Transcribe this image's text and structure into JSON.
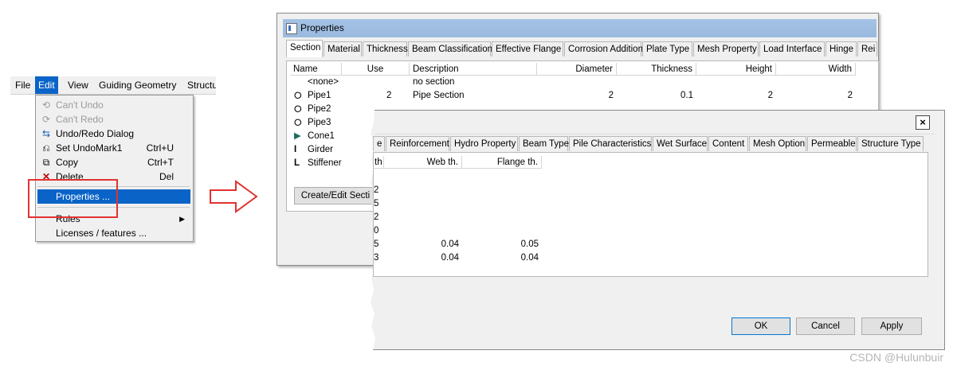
{
  "menubar": {
    "items": [
      "File",
      "Edit",
      "View",
      "Guiding Geometry",
      "Structu"
    ]
  },
  "edit_menu": {
    "items": [
      {
        "label": "Can't Undo",
        "shortcut": "",
        "icon": "undo-icon",
        "disabled": true
      },
      {
        "label": "Can't Redo",
        "shortcut": "",
        "icon": "redo-icon",
        "disabled": true
      },
      {
        "label": "Undo/Redo Dialog",
        "shortcut": "",
        "icon": "undo-redo-dialog-icon",
        "disabled": false
      },
      {
        "label": "Set UndoMark1",
        "shortcut": "Ctrl+U",
        "icon": "undo-mark-icon",
        "disabled": false
      },
      {
        "label": "Copy",
        "shortcut": "Ctrl+T",
        "icon": "copy-icon",
        "disabled": false
      },
      {
        "label": "Delete",
        "shortcut": "Del",
        "icon": "delete-icon",
        "disabled": false
      },
      {
        "label": "Properties ...",
        "shortcut": "",
        "icon": "",
        "selected": true
      },
      {
        "label": "Rules",
        "shortcut": "",
        "icon": "",
        "submenu": true
      },
      {
        "label": "Licenses / features ...",
        "shortcut": "",
        "icon": ""
      }
    ]
  },
  "properties_window": {
    "title": "Properties",
    "tabs": [
      "Section",
      "Material",
      "Thickness",
      "Beam Classification",
      "Effective Flange",
      "Corrosion Addition",
      "Plate Type",
      "Mesh Property",
      "Load Interface",
      "Hinge",
      "Rei"
    ],
    "columns": [
      "Name",
      "Use",
      "Description",
      "Diameter",
      "Thickness",
      "Height",
      "Width"
    ],
    "rows": [
      {
        "icon": "",
        "name": "<none>",
        "use": "",
        "description": "no section",
        "diameter": "",
        "thickness": "",
        "height": "",
        "width": ""
      },
      {
        "icon": "pipe-icon",
        "name": "Pipe1",
        "use": "2",
        "description": "Pipe Section",
        "diameter": "2",
        "thickness": "0.1",
        "height": "2",
        "width": "2"
      },
      {
        "icon": "pipe-icon",
        "name": "Pipe2",
        "use": "",
        "description": "",
        "diameter": "",
        "thickness": "",
        "height": "",
        "width": ""
      },
      {
        "icon": "pipe-icon",
        "name": "Pipe3",
        "use": "",
        "description": "",
        "diameter": "",
        "thickness": "",
        "height": "",
        "width": ""
      },
      {
        "icon": "cone-icon",
        "name": "Cone1",
        "use": "",
        "description": "",
        "diameter": "",
        "thickness": "",
        "height": "",
        "width": ""
      },
      {
        "icon": "i-beam-icon",
        "name": "Girder",
        "use": "",
        "description": "",
        "diameter": "",
        "thickness": "",
        "height": "",
        "width": ""
      },
      {
        "icon": "l-profile-icon",
        "name": "Stiffener",
        "use": "",
        "description": "",
        "diameter": "",
        "thickness": "",
        "height": "",
        "width": ""
      }
    ],
    "create_button": "Create/Edit Secti"
  },
  "second_window": {
    "tabs": [
      "e",
      "Reinforcement",
      "Hydro Property",
      "Beam Type",
      "Pile Characteristics",
      "Wet Surface",
      "Content",
      "Mesh Option",
      "Permeable",
      "Structure Type"
    ],
    "columns": [
      "th",
      "Web th.",
      "Flange th."
    ],
    "rows": [
      {
        "prefix": "2",
        "web": "",
        "flange": ""
      },
      {
        "prefix": "5",
        "web": "",
        "flange": ""
      },
      {
        "prefix": "2",
        "web": "",
        "flange": ""
      },
      {
        "prefix": "0",
        "web": "",
        "flange": ""
      },
      {
        "prefix": "5",
        "web": "0.04",
        "flange": "0.05"
      },
      {
        "prefix": "3",
        "web": "0.04",
        "flange": "0.04"
      }
    ],
    "buttons": {
      "ok": "OK",
      "cancel": "Cancel",
      "apply": "Apply"
    },
    "close": "×"
  },
  "watermark": "CSDN @Hulunbuir",
  "colors": {
    "highlight": "#0a64c8",
    "annotation_red": "#e23232",
    "titlebar": "#99b9df"
  }
}
